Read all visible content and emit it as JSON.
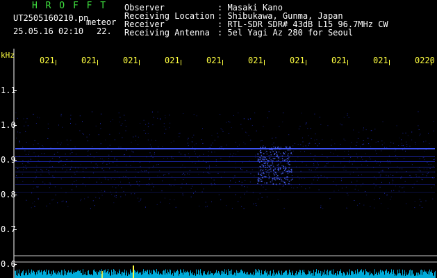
{
  "header": {
    "app_name": "H R O F F T",
    "filename": "UT2505160210.pn",
    "type_label": "meteor",
    "datetime": "25.05.16 02:10",
    "level": "22."
  },
  "info": {
    "labels": [
      "Observer",
      "Receiving Location",
      "Receiver",
      "Receiving Antenna"
    ],
    "values": [
      ": Masaki Kano",
      ": Shibukawa, Gunma, Japan",
      ": RTL-SDR SDR# 43dB L15 96.7MHz CW",
      ": 5el Yagi Az 280 for Seoul"
    ]
  },
  "axis": {
    "unit": "kHz",
    "y_ticks": [
      "1.1",
      "1.0",
      "0.9",
      "0.8",
      "0.7",
      "0.6"
    ],
    "x_ticks": [
      "021",
      "021",
      "021",
      "021",
      "021",
      "021",
      "021",
      "021",
      "021",
      "0220"
    ]
  },
  "colors": {
    "background": "#000000",
    "text": "#ffffff",
    "title": "#3fe23f",
    "time_labels": "#ffff40",
    "signal": "#2a3cff",
    "noise_floor": "#00c8ff"
  }
}
